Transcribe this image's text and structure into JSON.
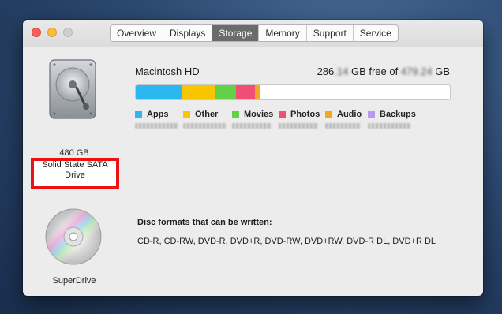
{
  "window": {
    "tabs": [
      {
        "label": "Overview",
        "active": false
      },
      {
        "label": "Displays",
        "active": false
      },
      {
        "label": "Storage",
        "active": true
      },
      {
        "label": "Memory",
        "active": false
      },
      {
        "label": "Support",
        "active": false
      },
      {
        "label": "Service",
        "active": false
      }
    ]
  },
  "drive": {
    "capacity": "480 GB",
    "name": "Solid State SATA Drive",
    "icon": "hard-drive-icon"
  },
  "volume": {
    "name": "Macintosh HD",
    "free_prefix": "286",
    "free_blurred": ".14",
    "free_middle": " GB free of ",
    "total_blurred": "479.24",
    "total_suffix": " GB"
  },
  "storage_usage": {
    "segments": [
      {
        "label": "Apps",
        "color": "#2bb8f0",
        "fraction": 0.145
      },
      {
        "label": "Other",
        "color": "#f7c600",
        "fraction": 0.11
      },
      {
        "label": "Movies",
        "color": "#62d148",
        "fraction": 0.065
      },
      {
        "label": "Photos",
        "color": "#f04f75",
        "fraction": 0.06
      },
      {
        "label": "Audio",
        "color": "#f5a623",
        "fraction": 0.015
      },
      {
        "label": "Backups",
        "color": "#b59cf0",
        "fraction": 0.0
      }
    ]
  },
  "superdrive": {
    "name": "SuperDrive",
    "icon": "cd-disc-icon",
    "heading": "Disc formats that can be written:",
    "formats": "CD-R, CD-RW, DVD-R, DVD+R, DVD-RW, DVD+RW, DVD-R DL, DVD+R DL"
  },
  "colors": {
    "close": "#fc605c",
    "minimize": "#fdbc40",
    "zoom": "#cfcfcf",
    "highlight_border": "#ee1111"
  }
}
